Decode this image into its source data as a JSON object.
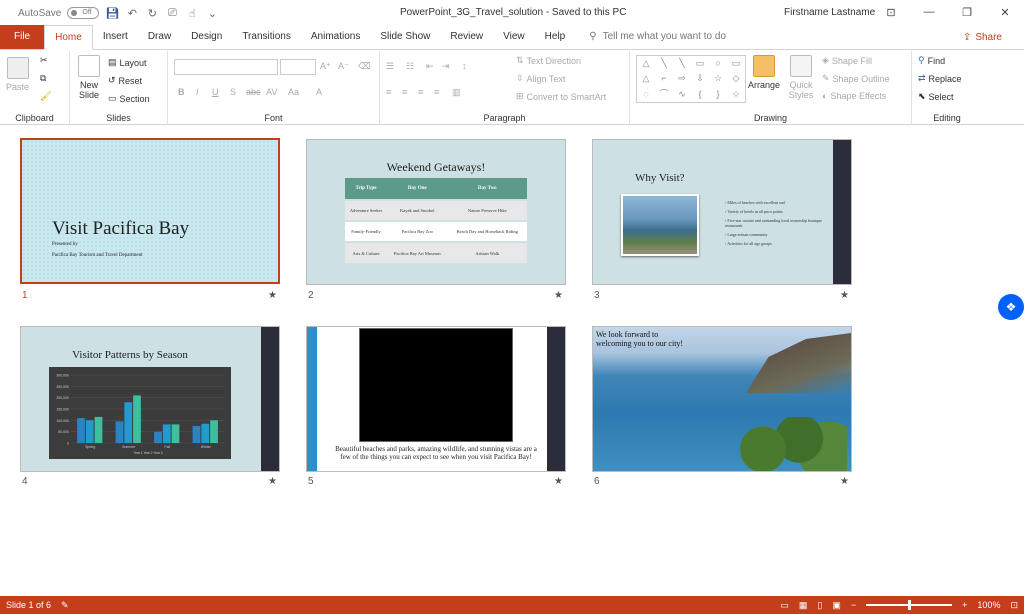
{
  "titlebar": {
    "autosave_label": "AutoSave",
    "autosave_state": "Off",
    "doc_title": "PowerPoint_3G_Travel_solution  -  Saved to this PC",
    "user": "Firstname Lastname",
    "icons": [
      "save-icon",
      "undo-icon",
      "redo-icon",
      "start-from-beginning-icon",
      "touch-mode-icon",
      "customize-qat-icon"
    ]
  },
  "tabs": {
    "file": "File",
    "items": [
      "Home",
      "Insert",
      "Draw",
      "Design",
      "Transitions",
      "Animations",
      "Slide Show",
      "Review",
      "View",
      "Help"
    ],
    "active": "Home",
    "tellme": "Tell me what you want to do",
    "share": "Share"
  },
  "ribbon": {
    "clipboard": {
      "label": "Clipboard",
      "paste": "Paste"
    },
    "slides": {
      "label": "Slides",
      "new_slide": "New Slide",
      "layout": "Layout",
      "reset": "Reset",
      "section": "Section"
    },
    "font": {
      "label": "Font",
      "bold": "B",
      "italic": "I",
      "underline": "U",
      "shadow": "S",
      "strike": "abc",
      "spacing": "AV",
      "case": "Aa"
    },
    "paragraph": {
      "label": "Paragraph",
      "text_direction": "Text Direction",
      "align_text": "Align Text",
      "smartart": "Convert to SmartArt"
    },
    "drawing": {
      "label": "Drawing",
      "arrange": "Arrange",
      "quick_styles": "Quick Styles",
      "shape_fill": "Shape Fill",
      "shape_outline": "Shape Outline",
      "shape_effects": "Shape Effects"
    },
    "editing": {
      "label": "Editing",
      "find": "Find",
      "replace": "Replace",
      "select": "Select"
    }
  },
  "slides": [
    {
      "number": "1",
      "selected": true,
      "title": "Visit Pacifica Bay",
      "line1": "Presented by",
      "line2": "Pacifica Bay Tourism and Travel Department"
    },
    {
      "number": "2",
      "title": "Weekend Getaways!",
      "headers": [
        "Trip Type",
        "Day One",
        "Day Two"
      ],
      "rows": [
        [
          "Adventure Seeker",
          "Kayak and Snorkel",
          "Nature Preserve Hike"
        ],
        [
          "Family-Friendly",
          "Pacifica Bay Zoo",
          "Beach Day and Horseback Riding"
        ],
        [
          "Arts & Culture",
          "Pacifica Bay Art Museum",
          "Artisan Walk"
        ]
      ]
    },
    {
      "number": "3",
      "title": "Why Visit?",
      "bullets": [
        "Miles of beaches with excellent surf",
        "Variety of hotels in all price points",
        "Five-star cuisine and outstanding local ownership boutique restaurants",
        "Large artisan community",
        "Activities for all age groups"
      ]
    },
    {
      "number": "4",
      "title": "Visitor Patterns by Season",
      "chart_axis": [
        "300,000",
        "250,000",
        "200,000",
        "150,000",
        "100,000",
        "50,000",
        "0"
      ],
      "chart_categories": [
        "Spring",
        "Summer",
        "Fall",
        "Winter"
      ],
      "chart_legend": "Year 1  Year 2  Year 3"
    },
    {
      "number": "5",
      "caption": "Beautiful beaches and parks, amazing wildlife, and stunning vistas are a few of the things you can expect to see when you visit Pacifica Bay!"
    },
    {
      "number": "6",
      "caption_line1": "We look forward to",
      "caption_line2": "welcoming you to our city!"
    }
  ],
  "slide_star": "★",
  "chart_data": {
    "type": "bar",
    "title": "Visitor Patterns by Season",
    "categories": [
      "Spring",
      "Summer",
      "Fall",
      "Winter"
    ],
    "series": [
      {
        "name": "Year 1",
        "values": [
          110000,
          95000,
          50000,
          75000
        ]
      },
      {
        "name": "Year 2",
        "values": [
          100000,
          180000,
          82000,
          85000
        ]
      },
      {
        "name": "Year 3",
        "values": [
          115000,
          210000,
          82000,
          100000
        ]
      }
    ],
    "ylim": [
      0,
      300000
    ],
    "colors": [
      "#2a84c4",
      "#1f9bcf",
      "#3fbf9f"
    ]
  },
  "status": {
    "slide": "Slide 1 of 6",
    "zoom": "100%",
    "minus": "−",
    "plus": "+"
  },
  "colors": {
    "accent": "#c43e1c"
  }
}
